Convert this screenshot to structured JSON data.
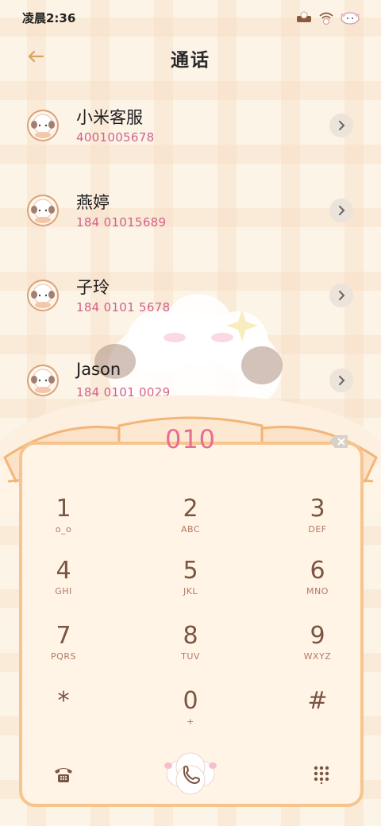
{
  "status_bar": {
    "time": "凌晨2:36"
  },
  "header": {
    "title": "通话"
  },
  "contacts": [
    {
      "name": "小米客服",
      "number": "4001005678"
    },
    {
      "name": "燕婷",
      "number": "184 01015689"
    },
    {
      "name": "子玲",
      "number": "184 0101 5678"
    },
    {
      "name": "Jason",
      "number": "184 0101 0029"
    }
  ],
  "dialpad": {
    "input": "010",
    "keys": [
      {
        "num": "1",
        "sub": "o_o"
      },
      {
        "num": "2",
        "sub": "ABC"
      },
      {
        "num": "3",
        "sub": "DEF"
      },
      {
        "num": "4",
        "sub": "GHI"
      },
      {
        "num": "5",
        "sub": "JKL"
      },
      {
        "num": "6",
        "sub": "MNO"
      },
      {
        "num": "7",
        "sub": "PQRS"
      },
      {
        "num": "8",
        "sub": "TUV"
      },
      {
        "num": "9",
        "sub": "WXYZ"
      },
      {
        "num": "*",
        "sub": ""
      },
      {
        "num": "0",
        "sub": "+"
      },
      {
        "num": "#",
        "sub": ""
      }
    ]
  },
  "colors": {
    "accent": "#e76d93",
    "number_text": "#d0628a",
    "key_text": "#7a5542",
    "border": "#f7c48e"
  },
  "icons": {
    "status": [
      "sheep-cart-icon",
      "wifi-sheep-icon",
      "battery-sheep-icon"
    ],
    "back": "arrow-left-icon",
    "chevron": "chevron-right-icon",
    "backspace": "backspace-icon",
    "bottom_left": "telephone-icon",
    "call": "call-icon",
    "bottom_right": "keypad-icon"
  }
}
